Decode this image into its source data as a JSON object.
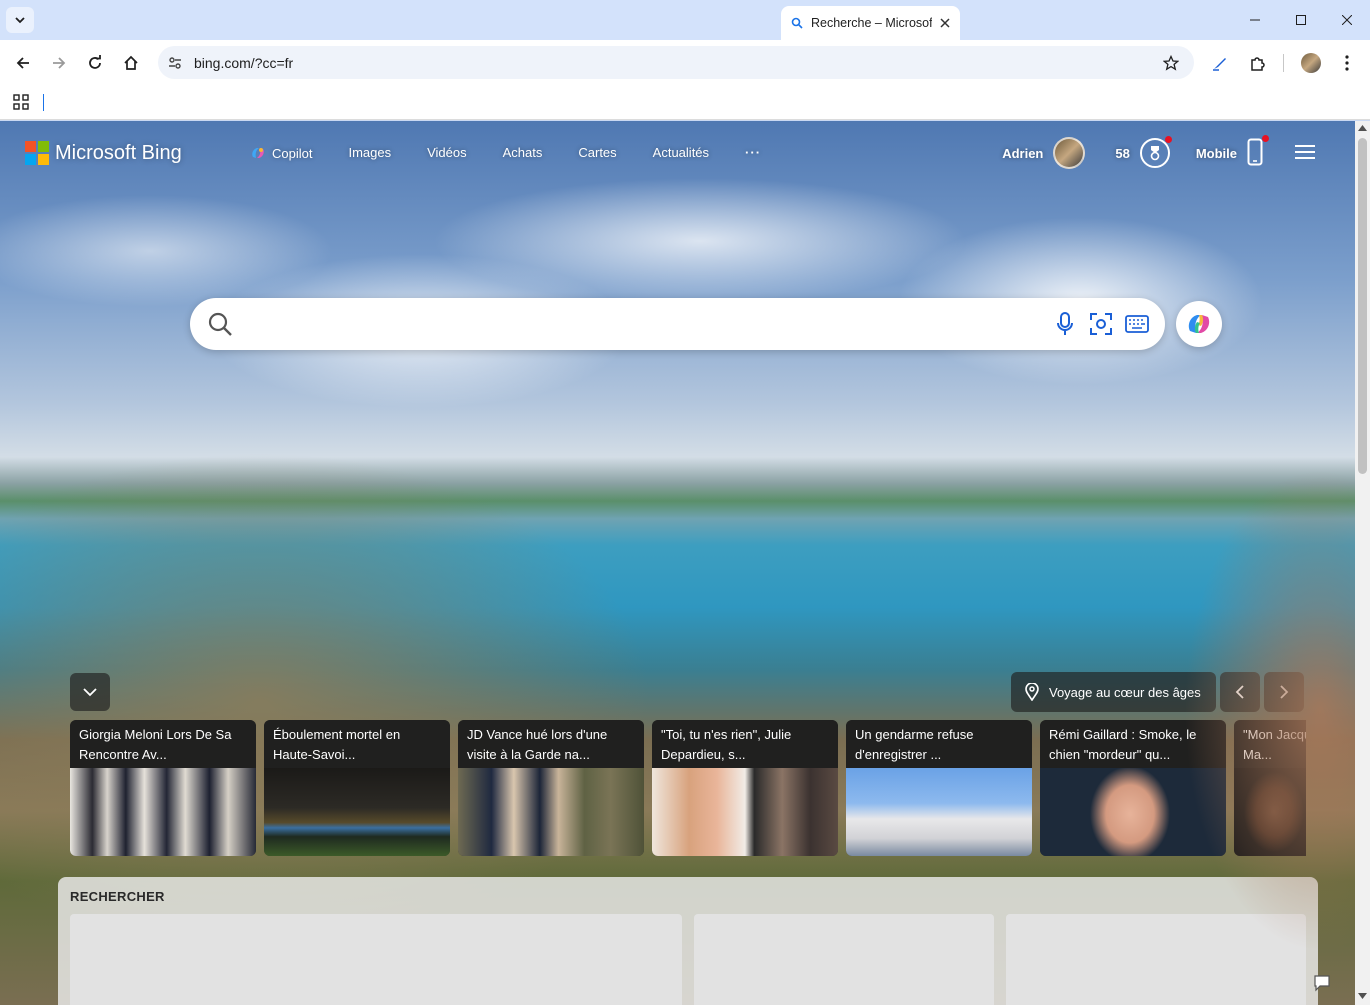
{
  "browser": {
    "tab_title": "Recherche – Microsoft Bing",
    "url": "bing.com/?cc=fr"
  },
  "header": {
    "logo_text": "Microsoft Bing",
    "nav": [
      "Copilot",
      "Images",
      "Vidéos",
      "Achats",
      "Cartes",
      "Actualités",
      "···"
    ],
    "user_name": "Adrien",
    "rewards_count": "58",
    "mobile_label": "Mobile"
  },
  "search": {
    "placeholder": "",
    "value": ""
  },
  "image_info": {
    "location_title": "Voyage au cœur des âges"
  },
  "news": [
    {
      "headline": "Giorgia Meloni Lors De Sa Rencontre Av..."
    },
    {
      "headline": "Éboulement mortel en Haute-Savoi..."
    },
    {
      "headline": "JD Vance hué lors d'une visite à la Garde na..."
    },
    {
      "headline": "\"Toi, tu n'es rien\", Julie Depardieu, s..."
    },
    {
      "headline": "Un gendarme refuse d'enregistrer ..."
    },
    {
      "headline": "Rémi Gaillard : Smoke, le chien \"mordeur\" qu..."
    },
    {
      "headline": "\"Mon Jacques, Jacques Ma..."
    }
  ],
  "rechercher": {
    "title": "RECHERCHER"
  },
  "colors": {
    "chrome_bg": "#d3e2fb",
    "logo_red": "#f35325",
    "logo_green": "#81bc06",
    "logo_blue": "#05a6f0",
    "logo_yellow": "#ffba08"
  }
}
